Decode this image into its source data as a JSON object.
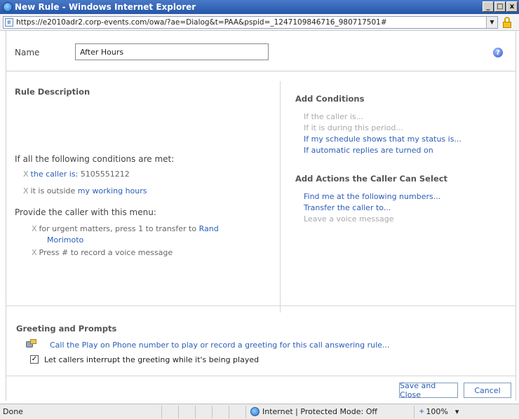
{
  "window": {
    "title": "New Rule - Windows Internet Explorer",
    "btn_min": "_",
    "btn_max": "□",
    "btn_close": "x"
  },
  "address": {
    "url": "https://e2010adr2.corp-events.com/owa/?ae=Dialog&t=PAA&pspid=_1247109846716_980717501#"
  },
  "name_field": {
    "label": "Name",
    "value": "After Hours"
  },
  "help_icon_glyph": "?",
  "rule_description": {
    "title": "Rule Description",
    "conditions_heading": "If all the following conditions are met:",
    "cond1_prefix": "the caller is:",
    "cond1_value": " 5105551212",
    "cond2_prefix": "it is outside ",
    "cond2_link": "my working hours",
    "menu_heading": "Provide the caller with this menu:",
    "menu1_prefix": "for urgent matters, press 1 to transfer to ",
    "menu1_link_a": "Rand",
    "menu1_link_b": "Morimoto",
    "menu2": "Press # to record a voice message",
    "remove_glyph": "X"
  },
  "add_conditions": {
    "title": "Add Conditions",
    "items": [
      {
        "label": "If the caller is...",
        "enabled": false
      },
      {
        "label": "If it is during this period...",
        "enabled": false
      },
      {
        "label": "If my schedule shows that my status is...",
        "enabled": true
      },
      {
        "label": "If automatic replies are turned on",
        "enabled": true
      }
    ]
  },
  "add_actions": {
    "title": "Add Actions the Caller Can Select",
    "items": [
      {
        "label": "Find me at the following numbers...",
        "enabled": true
      },
      {
        "label": "Transfer the caller to...",
        "enabled": true
      },
      {
        "label": "Leave a voice message",
        "enabled": false
      }
    ]
  },
  "greeting": {
    "title": "Greeting and Prompts",
    "link": "Call the Play on Phone number to play or record a greeting for this call answering rule...",
    "checkbox_label": "Let callers interrupt the greeting while it's being played",
    "checkbox_checked": true,
    "check_glyph": "✓"
  },
  "buttons": {
    "save": "Save and Close",
    "cancel": "Cancel"
  },
  "status": {
    "left": "Done",
    "zone": "Internet | Protected Mode: Off",
    "zoom": "100%",
    "zoom_glyph": "+",
    "zoom_drop": "▾"
  },
  "colors": {
    "link": "#2b5db8",
    "disabled": "#aaaaaa",
    "titlebar": "#2456a8"
  }
}
